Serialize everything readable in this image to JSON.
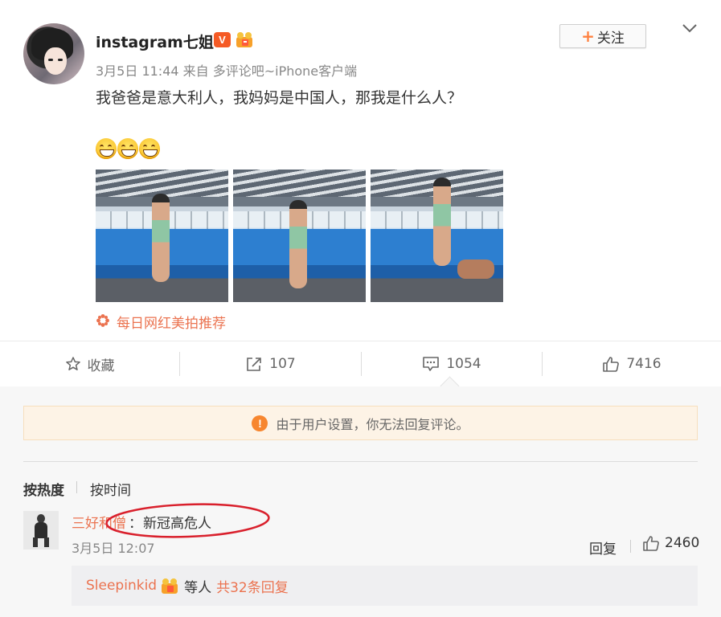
{
  "post": {
    "username": "instagram七姐",
    "v_badge": "V",
    "meta": "3月5日 11:44 来自 多评论吧~iPhone客户端",
    "text": "我爸爸是意大利人，我妈妈是中国人，那我是什么人？",
    "recommend": "每日网红美拍推荐",
    "follow_label": "关注",
    "follow_plus": "+"
  },
  "actions": {
    "favorite": "收藏",
    "share": "107",
    "comment": "1054",
    "like": "7416"
  },
  "notice": {
    "icon": "!",
    "text": "由于用户设置，你无法回复评论。"
  },
  "sort": {
    "hot": "按热度",
    "time": "按时间"
  },
  "comment": {
    "user": "三好和僧",
    "colon": "：",
    "text": "新冠高危人",
    "date": "3月5日 12:07",
    "reply_label": "回复",
    "likes": "2460",
    "sub": {
      "name": "Sleepinkid",
      "and_others": "等人",
      "total": "共32条回复"
    }
  },
  "colors": {
    "accent": "#eb7350",
    "notice_bg": "#fdf3e6",
    "v_badge": "#f55a25",
    "annotation": "#d9202c"
  },
  "icons": [
    "star-icon",
    "share-icon",
    "comment-icon",
    "thumb-up-icon",
    "chevron-down-icon",
    "warning-icon",
    "flower-icon",
    "grin-emoji-icon"
  ]
}
